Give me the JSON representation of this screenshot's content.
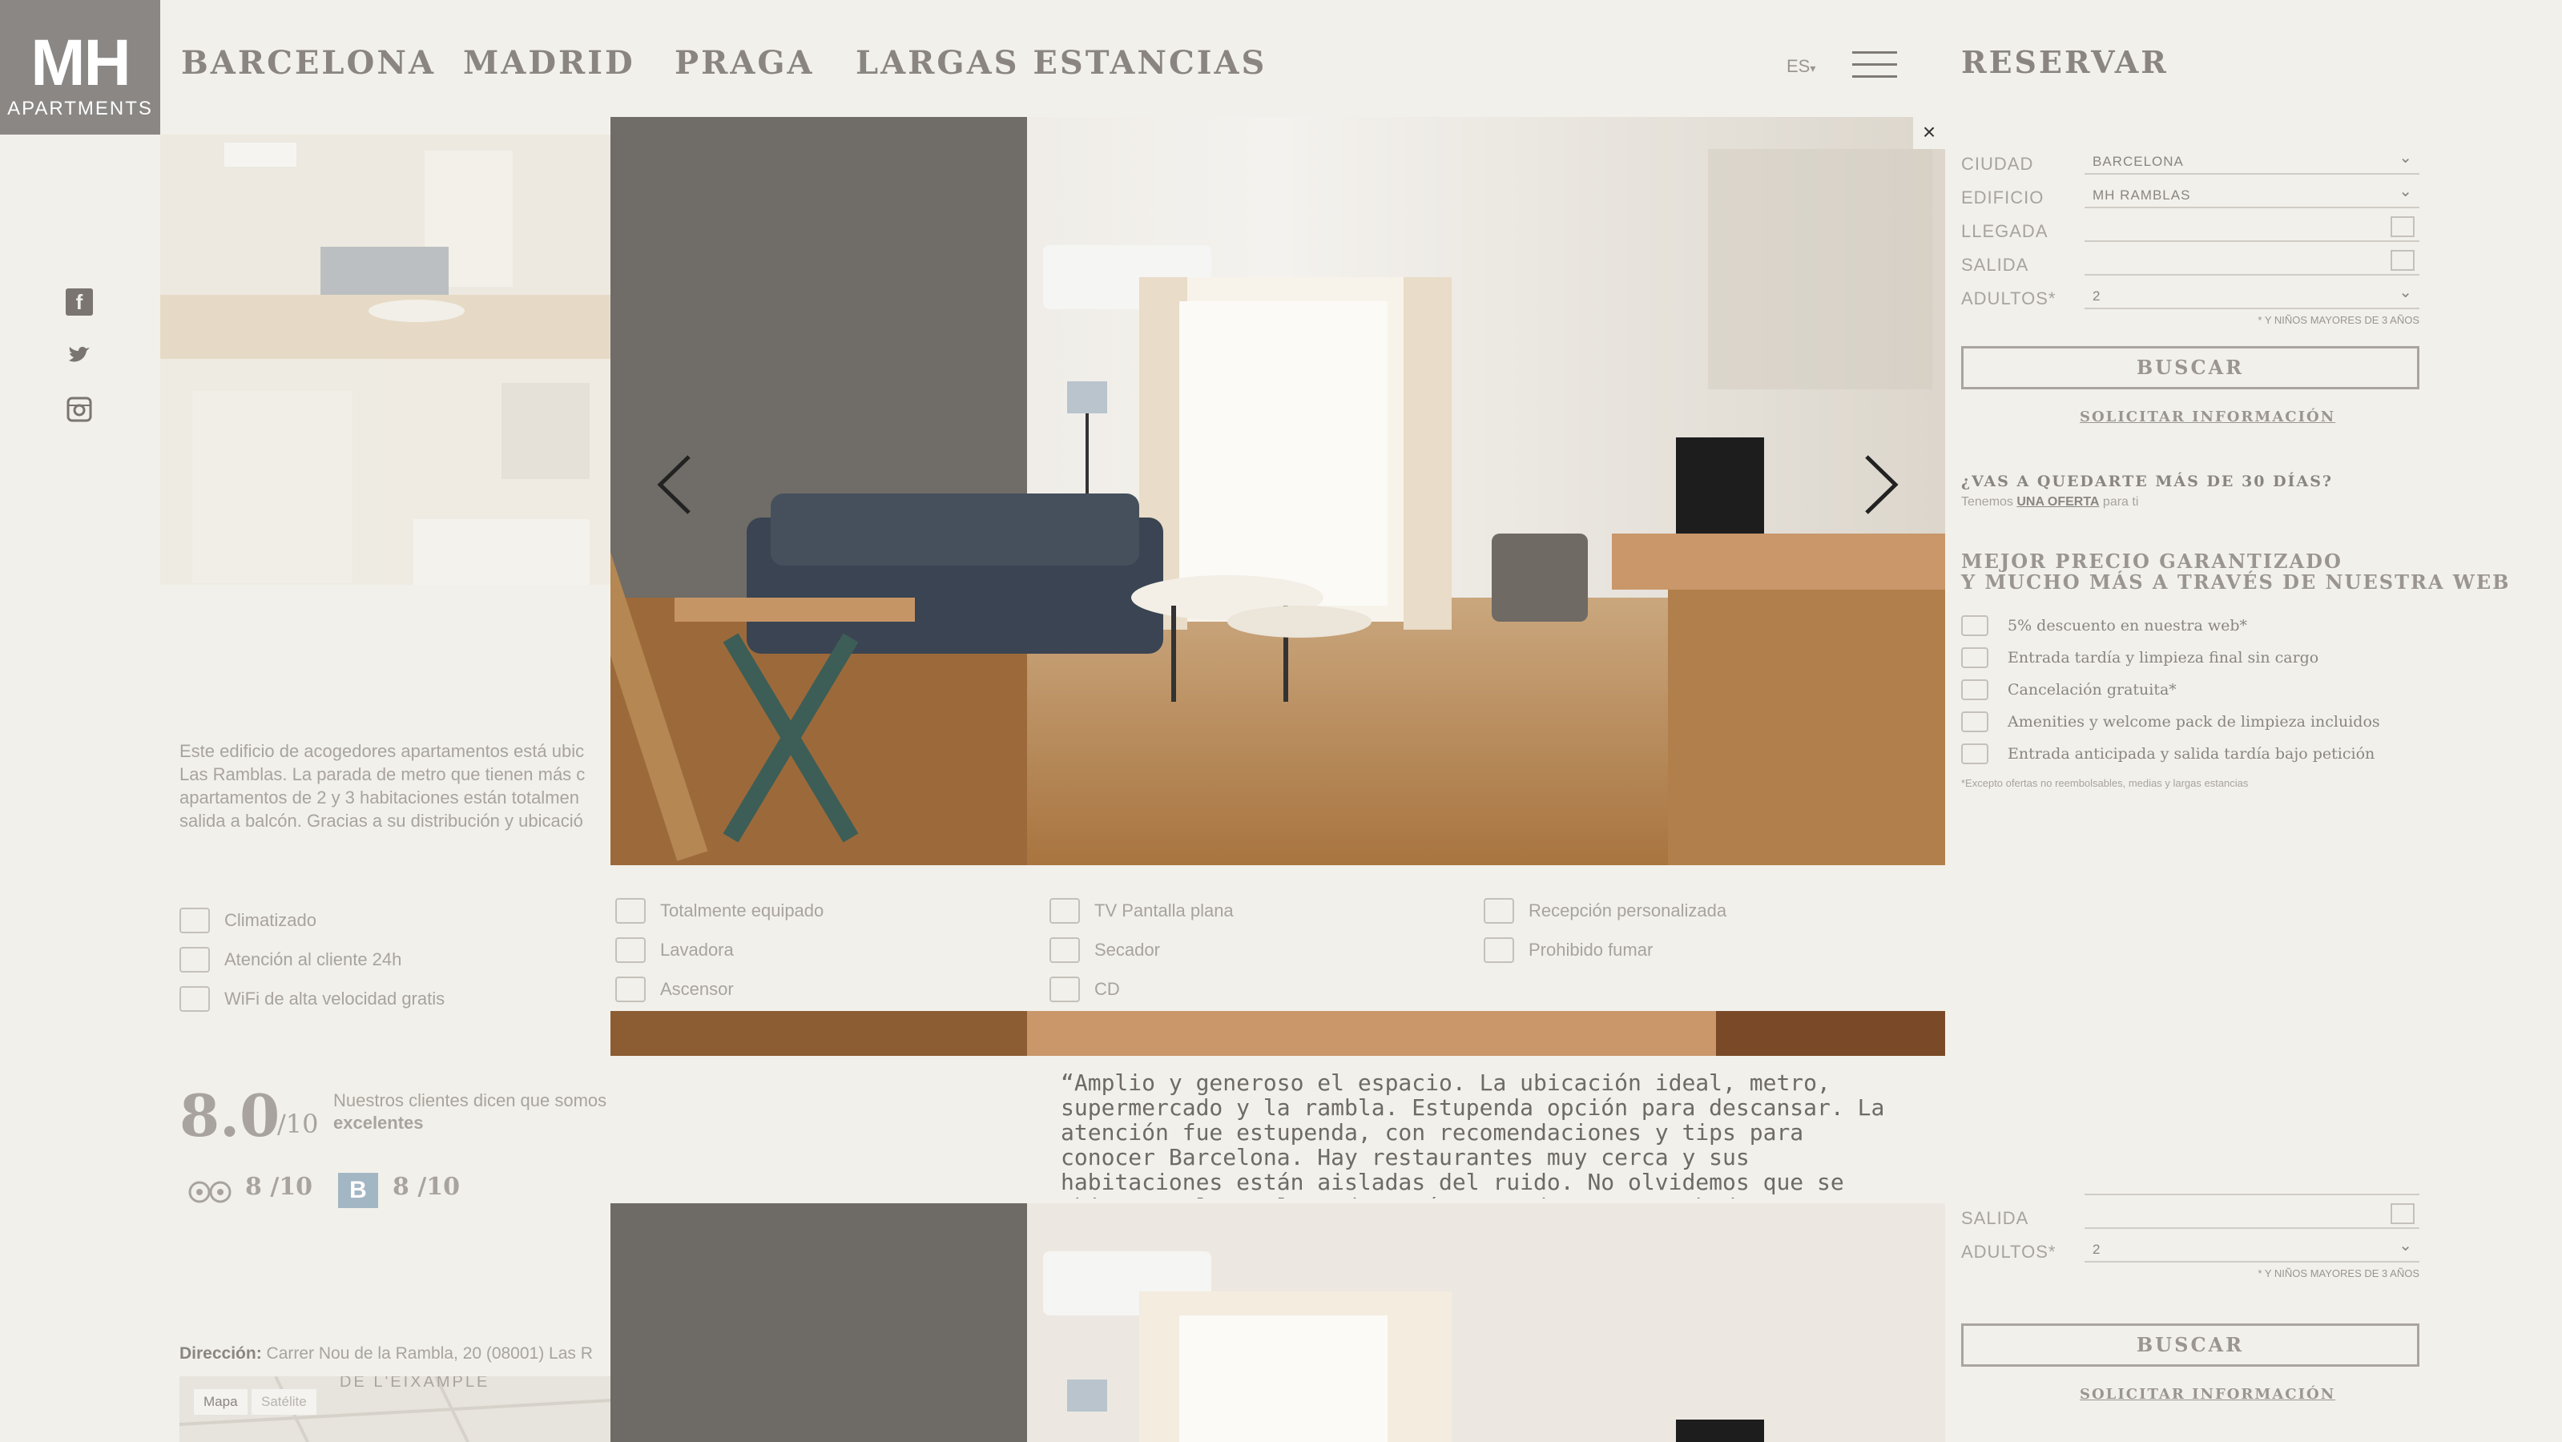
{
  "logo": {
    "mark": "MH",
    "sub": "APARTMENTS"
  },
  "nav": [
    "BARCELONA",
    "MADRID",
    "PRAGA",
    "LARGAS ESTANCIAS"
  ],
  "lang": "ES",
  "reservar": "RESERVAR",
  "social_icons": [
    "facebook-icon",
    "twitter-icon",
    "instagram-icon"
  ],
  "booking": {
    "fields": [
      {
        "label": "CIUDAD",
        "value": "BARCELONA",
        "icon": "chevron-down-icon"
      },
      {
        "label": "EDIFICIO",
        "value": "MH RAMBLAS",
        "icon": "chevron-down-icon"
      },
      {
        "label": "LLEGADA",
        "value": "",
        "icon": "calendar-in-icon"
      },
      {
        "label": "SALIDA",
        "value": "",
        "icon": "calendar-out-icon"
      },
      {
        "label": "ADULTOS*",
        "value": "2",
        "icon": "chevron-down-icon"
      }
    ],
    "children_note": "* Y NIÑOS MAYORES DE 3 AÑOS",
    "search": "BUSCAR",
    "info_link": "SOLICITAR INFORMACIÓN",
    "long_stay_q": "¿VAS A QUEDARTE MÁS DE 30 DÍAS?",
    "long_stay_pre": "Tenemos ",
    "long_stay_link": "UNA OFERTA",
    "long_stay_post": " para ti",
    "best_price_1": "MEJOR PRECIO GARANTIZADO",
    "best_price_2": "Y MUCHO MÁS A TRAVÉS DE NUESTRA WEB",
    "perks": [
      "5% descuento en nuestra web*",
      "Entrada tardía y limpieza final sin cargo",
      "Cancelación gratuita*",
      "Amenities y welcome pack de limpieza incluidos",
      "Entrada anticipada y salida tardía bajo petición"
    ],
    "perks_note": "*Excepto ofertas no reembolsables, medias y largas estancias"
  },
  "booking_lower": {
    "fields": [
      {
        "label": "SALIDA",
        "value": "",
        "icon": "calendar-out-icon"
      },
      {
        "label": "ADULTOS*",
        "value": "2",
        "icon": "chevron-down-icon"
      }
    ],
    "children_note": "* Y NIÑOS MAYORES DE 3 AÑOS",
    "search": "BUSCAR",
    "info_link": "SOLICITAR INFORMACIÓN"
  },
  "description": [
    "Este edificio de acogedores apartamentos está ubic",
    "Las Ramblas. La parada de metro que tienen más c",
    "apartamentos de 2 y 3 habitaciones están totalmen",
    "salida a balcón. Gracias a su distribución y ubicació"
  ],
  "amenities": [
    [
      "Climatizado",
      "Atención al cliente 24h",
      "WiFi de alta velocidad gratis"
    ],
    [
      "Totalmente equipado",
      "Lavadora",
      "Ascensor"
    ],
    [
      "TV Pantalla plana",
      "Secador",
      "CD"
    ],
    [
      "Recepción personalizada",
      "Prohibido fumar"
    ]
  ],
  "rating": {
    "score": "8.0",
    "out_of": "/10",
    "say_1": "Nuestros clientes dicen que somos",
    "say_2": "excelentes",
    "tripadvisor": "8 /10",
    "booking_badge": "B",
    "booking": "8 /10"
  },
  "address_label": "Dirección:",
  "address": " Carrer Nou de la Rambla, 20 (08001) Las R",
  "map_tabs": [
    "Mapa",
    "Satélite"
  ],
  "map_area": "DE L'EIXAMPLE",
  "review": "“Amplio y generoso el espacio. La ubicación ideal, metro, supermercado y la rambla. Estupenda opción para descansar. La atención fue estupenda, con recomendaciones y tips para conocer Barcelona. Hay restaurantes muy cerca y sus habitaciones están aisladas del ruido. No olvidemos que se ubica en el Raval. Todo está renovado y con acabados",
  "lightbox": {
    "close": "×"
  },
  "colors": {
    "background": "#f2f0ea",
    "logo_bg": "#8a8785",
    "text": "#9a9590",
    "accent": "#8a8580"
  }
}
